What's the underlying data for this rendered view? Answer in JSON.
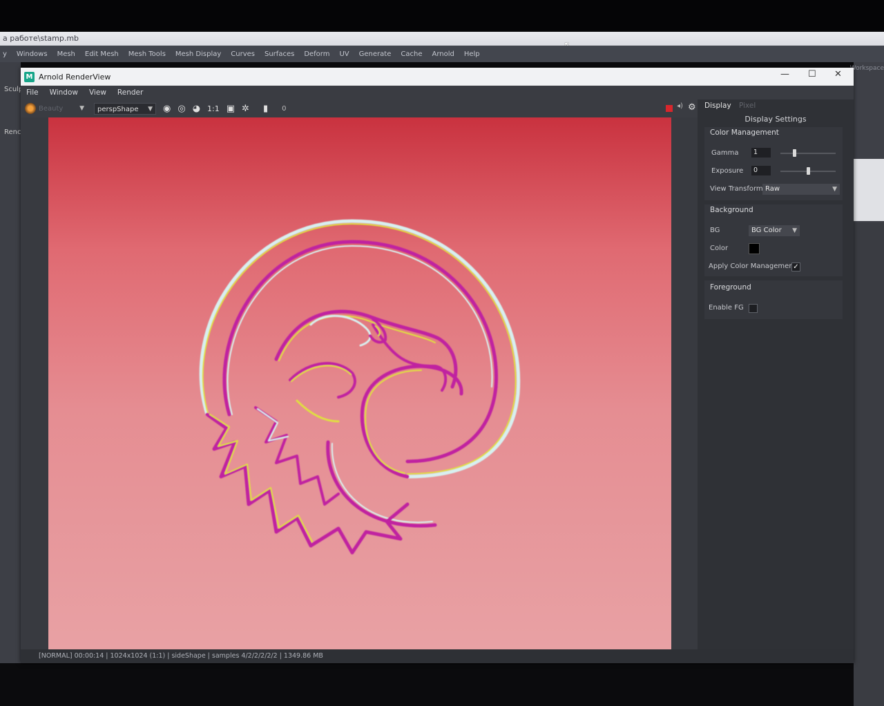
{
  "monitor": {
    "title_bar_path": "а работе\\stamp.mb"
  },
  "maya_menubar": [
    "y",
    "Windows",
    "Mesh",
    "Edit Mesh",
    "Mesh Tools",
    "Mesh Display",
    "Curves",
    "Surfaces",
    "Deform",
    "UV",
    "Generate",
    "Cache",
    "Arnold",
    "Help"
  ],
  "maya_side": {
    "label_top": "Sculp",
    "label_mid": "Renc"
  },
  "maya_right": {
    "workspace_label": "Workspace"
  },
  "render_view": {
    "title": "Arnold RenderView",
    "logo": "M",
    "window_buttons": {
      "minimize": "—",
      "maximize": "☐",
      "close": "✕"
    },
    "menu": [
      "File",
      "Window",
      "View",
      "Render"
    ],
    "toolbar": {
      "dim_select": "Beauty",
      "camera": "perspShape",
      "ratio": "1:1",
      "frame_value": "0"
    },
    "status_bar": "[NORMAL]  00:00:14 | 1024x1024 (1:1) | sideShape  | samples 4/2/2/2/2/2 | 1349.86 MB"
  },
  "display_panel": {
    "tab_active": "Display",
    "tab_inactive": "Pixel",
    "title": "Display Settings",
    "color_management": {
      "header": "Color Management",
      "gamma_label": "Gamma",
      "gamma_value": "1",
      "gamma_level": 0.25,
      "exposure_label": "Exposure",
      "exposure_value": "0",
      "exposure_level": 0.5,
      "view_transform_label": "View Transform",
      "view_transform_value": "Raw"
    },
    "background": {
      "header": "Background",
      "bg_label": "BG",
      "bg_value": "BG Color",
      "color_label": "Color",
      "color_value": "#000000",
      "apply_label": "Apply Color Management",
      "apply_checked": true
    },
    "foreground": {
      "header": "Foreground",
      "enable_label": "Enable FG",
      "enable_checked": false
    }
  },
  "colors": {
    "render_top": "#c9323f",
    "render_bottom": "#e8a1a4",
    "stamp_magenta": "#c020a0",
    "stamp_yellow": "#e0e040",
    "stamp_light": "#d8f0f0"
  }
}
